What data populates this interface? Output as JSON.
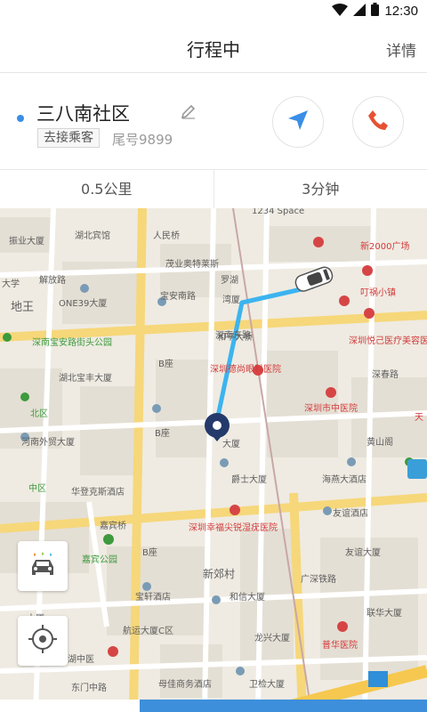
{
  "status_bar": {
    "time": "12:30"
  },
  "header": {
    "title": "行程中",
    "detail_label": "详情"
  },
  "trip": {
    "destination": "三八南社区",
    "tag": "去接乘客",
    "tail_number": "尾号9899",
    "distance": "0.5公里",
    "duration": "3分钟"
  },
  "icons": {
    "navigate": "navigate-arrow-icon",
    "phone": "phone-icon",
    "edit": "edit-pencil-icon",
    "car_mode": "car-icon",
    "locate": "locate-crosshair-icon"
  },
  "colors": {
    "route": "#3cb4ef",
    "accent_blue": "#3a8ee6",
    "phone_red": "#e55234",
    "bottom_bar": "#3d8fdc"
  },
  "map": {
    "labels": {
      "l1": "1234 Space",
      "l2": "湖北宾馆",
      "l3": "振业大厦",
      "l4": "人民桥",
      "l5": "新2000广场",
      "l6": "大学",
      "l7": "解放路",
      "l8": "茂业奥特莱斯",
      "l9": "罗湖",
      "l10": "叮祸小镇",
      "l11": "ONE39大厦",
      "l12": "地王",
      "l13": "湾厦",
      "l14": "深圳悦己医疗美容医院",
      "l15": "深南宝安路街头公园",
      "l16": "和平大桥",
      "l17": "湖北宝丰大厦",
      "l18": "深圳德尚眼科医院",
      "l19": "深春路",
      "l20": "北区",
      "l21": "深圳市中医院",
      "l22": "河南外贸大厦",
      "l23": "大厦",
      "l24": "黄山阁",
      "l25": "中区",
      "l26": "爵士大厦",
      "l27": "海燕大酒店",
      "l28": "华登克斯酒店",
      "l29": "嘉宾桥",
      "l30": "友谊酒店",
      "l31": "深圳幸福尖锐湿疣医院",
      "l32": "嘉宾公园",
      "l33": "友谊大厦",
      "l34": "新郊村",
      "l35": "宝轩酒店",
      "l36": "和信大厦",
      "l37": "联华大厦",
      "l38": "航运大厦C区",
      "l39": "龙兴大厦",
      "l40": "普华医院",
      "l41": "罗湖中医",
      "l42": "母佳商务酒店",
      "l43": "卫检大厦",
      "l44": "大厦",
      "l45": "天",
      "l46": "B座",
      "l47": "B座",
      "l48": "B座",
      "l49": "东门中路",
      "l50": "宝安南路",
      "l51": "深南东路",
      "l52": "广深铁路"
    }
  }
}
